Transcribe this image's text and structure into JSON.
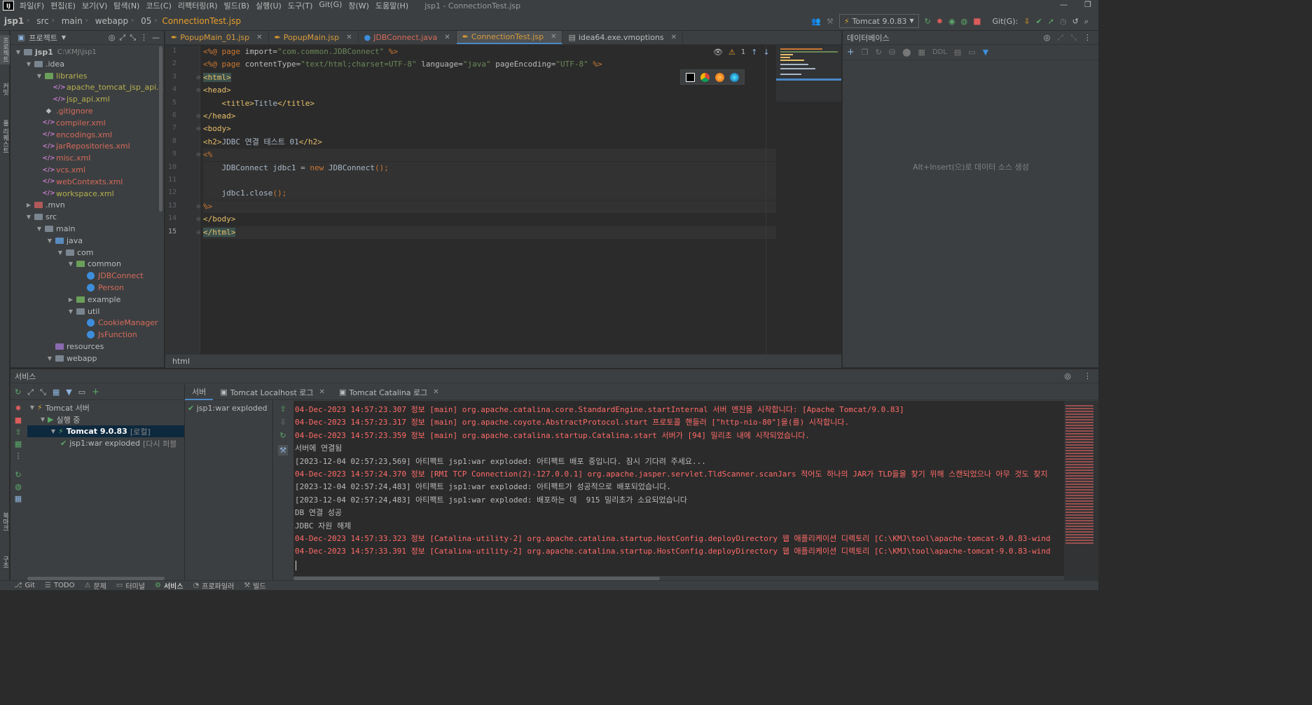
{
  "menubar": {
    "items": [
      "파일(F)",
      "편집(E)",
      "보기(V)",
      "탐색(N)",
      "코드(C)",
      "리팩터링(R)",
      "빌드(B)",
      "실행(U)",
      "도구(T)",
      "Git(G)",
      "창(W)",
      "도움말(H)"
    ],
    "window_title": "jsp1 - ConnectionTest.jsp"
  },
  "navbar": {
    "breadcrumbs": [
      "jsp1",
      "src",
      "main",
      "webapp",
      "05",
      "ConnectionTest.jsp"
    ],
    "run_config": "Tomcat 9.0.83",
    "git_label": "Git(G):"
  },
  "left_strip": {
    "tab_project": "프로젝트",
    "tab_commit": "커밋",
    "tab_pull_requests": "풀 리퀘스트",
    "tab_bookmarks": "북마크",
    "tab_structure": "구조"
  },
  "project_panel": {
    "title": "프로젝트",
    "tree": [
      {
        "label": "jsp1",
        "hint": "C:\\KMJ\\jsp1",
        "depth": 0,
        "arrow": "open",
        "icon": "module",
        "color": "#bbbbbb"
      },
      {
        "label": ".idea",
        "depth": 1,
        "arrow": "open",
        "icon": "folder-gray",
        "color": "#bbbbbb"
      },
      {
        "label": "libraries",
        "depth": 2,
        "arrow": "open",
        "icon": "folder-lib",
        "color": "#b6b04f"
      },
      {
        "label": "apache_tomcat_jsp_api.xml",
        "depth": 3,
        "arrow": "",
        "icon": "xml",
        "color": "#b6b04f"
      },
      {
        "label": "jsp_api.xml",
        "depth": 3,
        "arrow": "",
        "icon": "xml",
        "color": "#b6b04f"
      },
      {
        "label": ".gitignore",
        "depth": 2,
        "arrow": "",
        "icon": "git",
        "color": "#d66b5b"
      },
      {
        "label": "compiler.xml",
        "depth": 2,
        "arrow": "",
        "icon": "xml",
        "color": "#d66b5b"
      },
      {
        "label": "encodings.xml",
        "depth": 2,
        "arrow": "",
        "icon": "xml",
        "color": "#d66b5b"
      },
      {
        "label": "jarRepositories.xml",
        "depth": 2,
        "arrow": "",
        "icon": "xml",
        "color": "#d66b5b"
      },
      {
        "label": "misc.xml",
        "depth": 2,
        "arrow": "",
        "icon": "xml",
        "color": "#d66b5b"
      },
      {
        "label": "vcs.xml",
        "depth": 2,
        "arrow": "",
        "icon": "xml",
        "color": "#d66b5b"
      },
      {
        "label": "webContexts.xml",
        "depth": 2,
        "arrow": "",
        "icon": "xml",
        "color": "#d66b5b"
      },
      {
        "label": "workspace.xml",
        "depth": 2,
        "arrow": "",
        "icon": "xml",
        "color": "#b6b04f"
      },
      {
        "label": ".mvn",
        "depth": 1,
        "arrow": "closed",
        "icon": "folder-red",
        "color": "#bbbbbb"
      },
      {
        "label": "src",
        "depth": 1,
        "arrow": "open",
        "icon": "folder-gray",
        "color": "#bbbbbb"
      },
      {
        "label": "main",
        "depth": 2,
        "arrow": "open",
        "icon": "folder-gray",
        "color": "#bbbbbb"
      },
      {
        "label": "java",
        "depth": 3,
        "arrow": "open",
        "icon": "folder-src",
        "color": "#bbbbbb"
      },
      {
        "label": "com",
        "depth": 4,
        "arrow": "open",
        "icon": "folder-gray",
        "color": "#bbbbbb"
      },
      {
        "label": "common",
        "depth": 5,
        "arrow": "open",
        "icon": "folder-lib",
        "color": "#bbbbbb"
      },
      {
        "label": "JDBConnect",
        "depth": 6,
        "arrow": "",
        "icon": "class",
        "color": "#d66b5b"
      },
      {
        "label": "Person",
        "depth": 6,
        "arrow": "",
        "icon": "class",
        "color": "#d66b5b"
      },
      {
        "label": "example",
        "depth": 5,
        "arrow": "closed",
        "icon": "folder-lib",
        "color": "#bbbbbb"
      },
      {
        "label": "util",
        "depth": 5,
        "arrow": "open",
        "icon": "folder-gray",
        "color": "#bbbbbb"
      },
      {
        "label": "CookieManager",
        "depth": 6,
        "arrow": "",
        "icon": "class",
        "color": "#d66b5b"
      },
      {
        "label": "JsFunction",
        "depth": 6,
        "arrow": "",
        "icon": "class",
        "color": "#d66b5b"
      },
      {
        "label": "resources",
        "depth": 3,
        "arrow": "",
        "icon": "folder-res",
        "color": "#bbbbbb"
      },
      {
        "label": "webapp",
        "depth": 3,
        "arrow": "open",
        "icon": "folder-gray",
        "color": "#bbbbbb"
      }
    ]
  },
  "editor": {
    "tabs": [
      {
        "label": "PopupMain_01.jsp",
        "kind": "jsp",
        "color": "#d89b3c",
        "active": false
      },
      {
        "label": "PopupMain.jsp",
        "kind": "jsp",
        "color": "#d89b3c",
        "active": false
      },
      {
        "label": "JDBConnect.java",
        "kind": "java",
        "color": "#d66b5b",
        "active": false
      },
      {
        "label": "ConnectionTest.jsp",
        "kind": "jsp",
        "color": "#d89b3c",
        "active": true
      },
      {
        "label": "idea64.exe.vmoptions",
        "kind": "opts",
        "color": "#bbbbbb",
        "active": false
      }
    ],
    "current_line": 15,
    "lines": [
      [
        {
          "t": "<%@ ",
          "c": "dir"
        },
        {
          "t": "page ",
          "c": "kw"
        },
        {
          "t": "import=",
          "c": "at"
        },
        {
          "t": "\"com.common.JDBConnect\"",
          "c": "sv"
        },
        {
          "t": " %>",
          "c": "dir"
        }
      ],
      [
        {
          "t": "<%@ ",
          "c": "dir"
        },
        {
          "t": "page ",
          "c": "kw"
        },
        {
          "t": "contentType=",
          "c": "at"
        },
        {
          "t": "\"text/html;charset=UTF-8\"",
          "c": "sv"
        },
        {
          "t": " language=",
          "c": "at"
        },
        {
          "t": "\"java\"",
          "c": "sv"
        },
        {
          "t": " pageEncoding=",
          "c": "at"
        },
        {
          "t": "\"UTF-8\"",
          "c": "sv"
        },
        {
          "t": " %>",
          "c": "dir"
        }
      ],
      [
        {
          "t": "<html>",
          "c": "tagmark"
        }
      ],
      [
        {
          "t": "<head>",
          "c": "tg"
        }
      ],
      [
        {
          "t": "    ",
          "c": ""
        },
        {
          "t": "<title>",
          "c": "tg"
        },
        {
          "t": "Title",
          "c": ""
        },
        {
          "t": "</title>",
          "c": "tg"
        }
      ],
      [
        {
          "t": "</head>",
          "c": "tg"
        }
      ],
      [
        {
          "t": "<body>",
          "c": "tg"
        }
      ],
      [
        {
          "t": "<h2>",
          "c": "tg"
        },
        {
          "t": "JDBC 연결 테스트 01",
          "c": ""
        },
        {
          "t": "</h2>",
          "c": "tg"
        }
      ],
      [
        {
          "t": "<%",
          "c": "dir"
        }
      ],
      [
        {
          "t": "    JDBConnect jdbc1 = ",
          "c": ""
        },
        {
          "t": "new ",
          "c": "kw"
        },
        {
          "t": "JDBConnect",
          "c": ""
        },
        {
          "t": "();",
          "c": "dir"
        }
      ],
      [
        {
          "t": "",
          "c": ""
        }
      ],
      [
        {
          "t": "    jdbc1.close",
          "c": ""
        },
        {
          "t": "();",
          "c": "dir"
        }
      ],
      [
        {
          "t": "%>",
          "c": "dir"
        }
      ],
      [
        {
          "t": "</body>",
          "c": "tg"
        }
      ],
      [
        {
          "t": "</html>",
          "c": "tagmark"
        }
      ]
    ],
    "inspection_count": "1",
    "status_crumb": "html"
  },
  "database_panel": {
    "title": "데이터베이스",
    "ddl_label": "DDL",
    "empty_hint": "Alt+Insert(으)로 데이터 소스 생성"
  },
  "services": {
    "title": "서비스",
    "tree": [
      {
        "label": "Tomcat 서버",
        "depth": 0,
        "arrow": "open",
        "selected": false
      },
      {
        "label": "실행 중",
        "depth": 1,
        "arrow": "open",
        "selected": false
      },
      {
        "label": "Tomcat 9.0.83",
        "hint": "[로컬]",
        "depth": 2,
        "arrow": "open",
        "selected": true
      },
      {
        "label": "jsp1:war exploded",
        "hint": "[다시 퍼블",
        "depth": 3,
        "arrow": "",
        "selected": false
      }
    ],
    "log_tabs": [
      {
        "label": "서버",
        "active": true,
        "closable": false
      },
      {
        "label": "Tomcat Localhost 로그",
        "active": false,
        "closable": true
      },
      {
        "label": "Tomcat Catalina 로그",
        "active": false,
        "closable": true
      }
    ],
    "deployment": "jsp1:war exploded",
    "log": [
      {
        "text": "04-Dec-2023 14:57:23.307 정보 [main] org.apache.catalina.core.StandardEngine.startInternal 서버 엔진을 시작합니다: [Apache Tomcat/9.0.83]",
        "red": true
      },
      {
        "text": "04-Dec-2023 14:57:23.317 정보 [main] org.apache.coyote.AbstractProtocol.start 프로토콜 핸들러 [\"http-nio-80\"]을(를) 시작합니다.",
        "red": true
      },
      {
        "text": "04-Dec-2023 14:57:23.359 정보 [main] org.apache.catalina.startup.Catalina.start 서버가 [94] 밀리초 내에 시작되었습니다.",
        "red": true
      },
      {
        "text": "서버에 연결됨",
        "red": false
      },
      {
        "text": "[2023-12-04 02:57:23,569] 아티팩트 jsp1:war exploded: 아티팩트 배포 중입니다. 잠시 기다려 주세요...",
        "red": false
      },
      {
        "text": "04-Dec-2023 14:57:24.370 정보 [RMI TCP Connection(2)-127.0.0.1] org.apache.jasper.servlet.TldScanner.scanJars 적어도 하나의 JAR가 TLD들을 찾기 위해 스캔되었으나 아무 것도 찾지",
        "red": true
      },
      {
        "text": "[2023-12-04 02:57:24,483] 아티팩트 jsp1:war exploded: 아티팩트가 성공적으로 배포되었습니다.",
        "red": false
      },
      {
        "text": "[2023-12-04 02:57:24,483] 아티팩트 jsp1:war exploded: 배포하는 데  915 밀리초가 소요되었습니다",
        "red": false
      },
      {
        "text": "DB 연결 성공",
        "red": false
      },
      {
        "text": "JDBC 자원 해제",
        "red": false
      },
      {
        "text": "04-Dec-2023 14:57:33.323 정보 [Catalina-utility-2] org.apache.catalina.startup.HostConfig.deployDirectory 웹 애플리케이션 디렉토리 [C:\\KMJ\\tool\\apache-tomcat-9.0.83-wind",
        "red": true
      },
      {
        "text": "04-Dec-2023 14:57:33.391 정보 [Catalina-utility-2] org.apache.catalina.startup.HostConfig.deployDirectory 웹 애플리케이션 디렉토리 [C:\\KMJ\\tool\\apache-tomcat-9.0.83-wind",
        "red": true
      }
    ]
  },
  "bottombar": {
    "items": [
      {
        "label": "Git",
        "active": false
      },
      {
        "label": "TODO",
        "active": false
      },
      {
        "label": "문제",
        "active": false
      },
      {
        "label": "터미널",
        "active": false
      },
      {
        "label": "서비스",
        "active": true
      },
      {
        "label": "프로파일러",
        "active": false
      },
      {
        "label": "빌드",
        "active": false
      }
    ]
  }
}
